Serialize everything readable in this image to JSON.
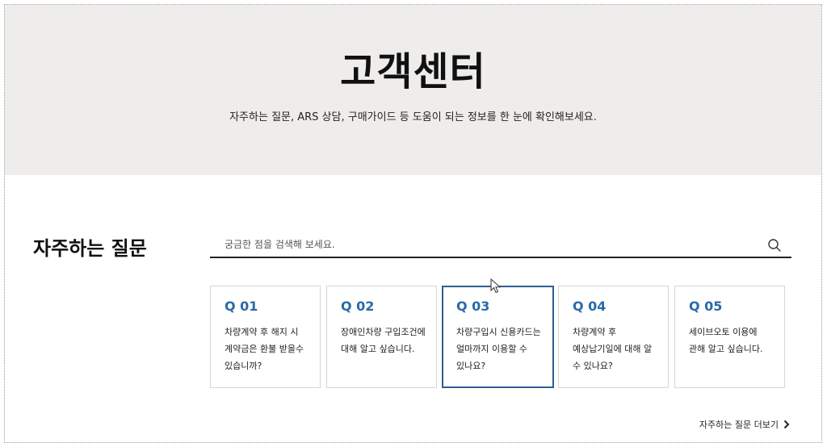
{
  "hero": {
    "title": "고객센터",
    "subtitle": "자주하는 질문, ARS 상담, 구매가이드 등 도움이 되는 정보를 한 눈에 확인해보세요."
  },
  "faq": {
    "heading": "자주하는 질문",
    "search": {
      "placeholder": "궁금한 점을 검색해 보세요.",
      "value": "",
      "button_icon": "search-icon"
    },
    "cards": [
      {
        "q": "Q 01",
        "text": "차량계약 후 해지 시 계약금은 환불 받을수 있습니까?",
        "active": false
      },
      {
        "q": "Q 02",
        "text": "장애인차량 구입조건에 대해 알고 싶습니다.",
        "active": false
      },
      {
        "q": "Q 03",
        "text": "차량구입시 신용카드는 얼마까지 이용할 수 있나요?",
        "active": true
      },
      {
        "q": "Q 04",
        "text": "차량계약 후 예상납기일에 대해 알 수 있나요?",
        "active": false
      },
      {
        "q": "Q 05",
        "text": "세이브오토 이용에 관해 알고 싶습니다.",
        "active": false
      }
    ],
    "more_label": "자주하는 질문 더보기",
    "more_icon": "chevron-right-icon"
  },
  "colors": {
    "hero_bg": "#efedeb",
    "accent": "#2a6aa8",
    "active_border": "#2d5f93"
  }
}
